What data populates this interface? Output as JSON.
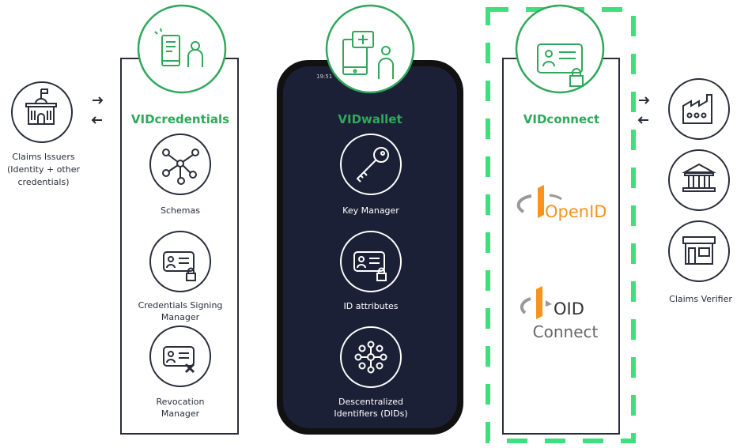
{
  "colors": {
    "accent": "#2fa85a",
    "dashed_highlight": "#3ee07e",
    "phone_screen": "#1c2036",
    "ink": "#2a2d3a",
    "openid_orange": "#f7931e"
  },
  "issuers": {
    "label_lines": [
      "Claims Issuers",
      "(Identity + other",
      "credentials)"
    ]
  },
  "vidcredentials": {
    "title": "VIDcredentials",
    "items": [
      {
        "icon": "network-icon",
        "lines": [
          "Schemas"
        ]
      },
      {
        "icon": "id-card-lock-icon",
        "lines": [
          "Credentials Signing",
          "Manager"
        ]
      },
      {
        "icon": "id-card-x-icon",
        "lines": [
          "Revocation",
          "Manager"
        ]
      }
    ]
  },
  "vidwallet": {
    "status_time": "19:51",
    "title": "VIDwallet",
    "items": [
      {
        "icon": "key-icon",
        "lines": [
          "Key Manager"
        ]
      },
      {
        "icon": "id-card-lock-icon",
        "lines": [
          "ID attributes"
        ]
      },
      {
        "icon": "did-network-icon",
        "lines": [
          "Descentralized",
          "Identifiers (DIDs)"
        ]
      }
    ]
  },
  "vidconnect": {
    "title": "VIDconnect",
    "logos": [
      {
        "name": "OpenID",
        "text": "OpenID"
      },
      {
        "name": "OIDC",
        "text_top": "OID",
        "text_bottom": "Connect"
      }
    ]
  },
  "verifier": {
    "label": "Claims Verifier",
    "icons": [
      "factory-icon",
      "bank-icon",
      "store-icon"
    ]
  }
}
